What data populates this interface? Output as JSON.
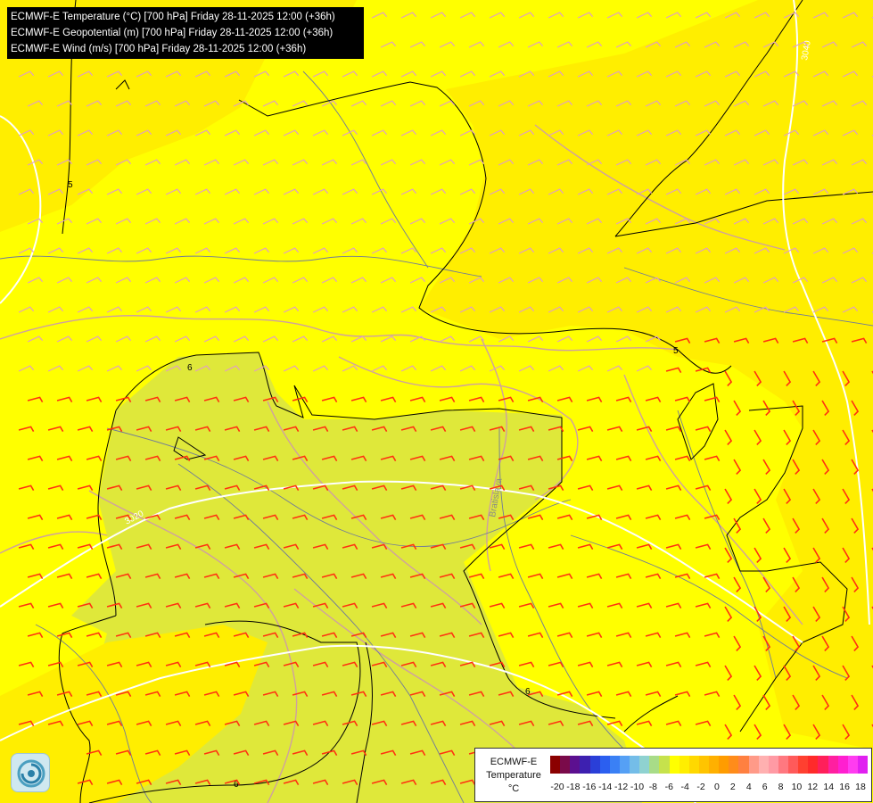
{
  "titles": [
    "ECMWF-E Temperature (°C) [700 hPa] Friday 28-11-2025 12:00 (+36h)",
    "ECMWF-E Geopotential (m) [700 hPa] Friday 28-11-2025 12:00 (+36h)",
    "ECMWF-E Wind (m/s) [700 hPa] Friday 28-11-2025 12:00 (+36h)"
  ],
  "labels": {
    "isotherm_5_left": "5",
    "isotherm_5_mid": "5",
    "isotherm_6_upper": "6",
    "isotherm_6_lower_mid": "6",
    "isotherm_6_bottom": "6",
    "geopotential_3020": "3020",
    "geopotential_3040": "3040",
    "city": "Bratislava"
  },
  "legend": {
    "title_lines": [
      "ECMWF-E",
      "Temperature",
      "°C"
    ],
    "ticks": [
      "-20",
      "-18",
      "-16",
      "-14",
      "-12",
      "-10",
      "-8",
      "-6",
      "-4",
      "-2",
      "0",
      "2",
      "4",
      "6",
      "8",
      "10",
      "12",
      "14",
      "16",
      "18"
    ],
    "colors": [
      "#8b0000",
      "#7a0a4a",
      "#5c1090",
      "#3d20b0",
      "#2a3fd8",
      "#2b5ff0",
      "#3a80f5",
      "#55a0f5",
      "#74bde8",
      "#8fd2d0",
      "#a8dc88",
      "#c6e24c",
      "#ffff00",
      "#ffee00",
      "#ffd800",
      "#ffc400",
      "#ffb000",
      "#ff9c00",
      "#ff8c1a",
      "#ff8040",
      "#ff9a88",
      "#ffb0b0",
      "#ff9aa4",
      "#ff7880",
      "#ff5a5a",
      "#ff4030",
      "#ff2a2a",
      "#ff1f5a",
      "#ff1fa0",
      "#ff1fd0",
      "#ff3cf0",
      "#e020f0"
    ]
  },
  "map_colors": {
    "warm_5": "#ffff00",
    "warm_4": "#ffee00",
    "warm_6": "#ffd400",
    "cool_region": "#dfe83a",
    "borders": "#cfa0a0",
    "rivers": "#707a9a",
    "geopotential": "#ffffff",
    "isotherm": "#000000",
    "barb_weak": "#e0a0c0",
    "barb_strong": "#ff3010"
  }
}
